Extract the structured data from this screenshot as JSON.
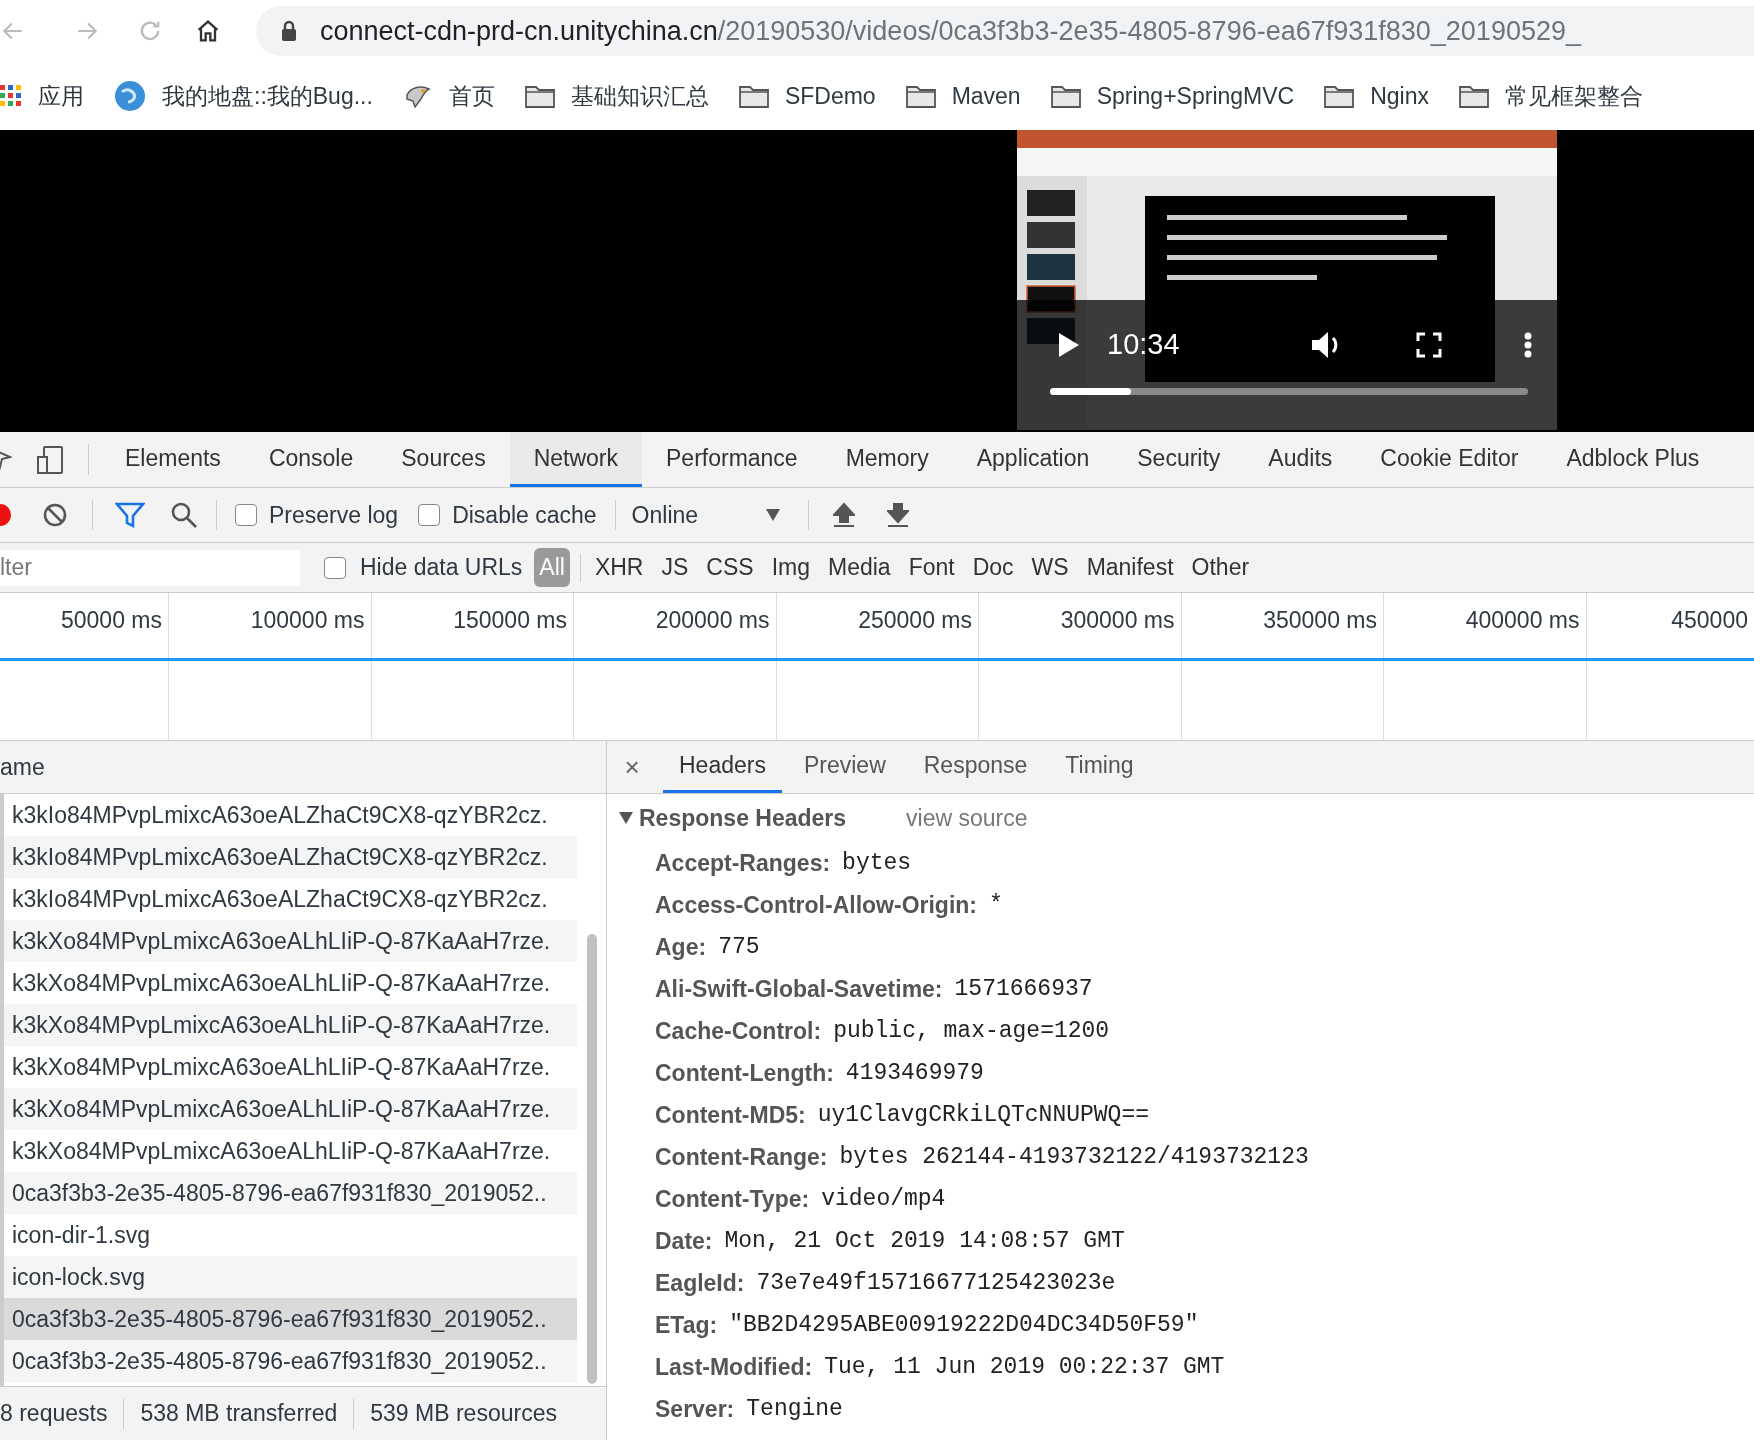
{
  "address": {
    "host": "connect-cdn-prd-cn.unitychina.cn",
    "path": "/20190530/videos/0ca3f3b3-2e35-4805-8796-ea67f931f830_20190529_"
  },
  "bookmarks": [
    {
      "label": "应用",
      "kind": "apps"
    },
    {
      "label": "我的地盘::我的Bug...",
      "kind": "globe"
    },
    {
      "label": "首页",
      "kind": "bird"
    },
    {
      "label": "基础知识汇总",
      "kind": "folder"
    },
    {
      "label": "SFDemo",
      "kind": "folder"
    },
    {
      "label": "Maven",
      "kind": "folder"
    },
    {
      "label": "Spring+SpringMVC",
      "kind": "folder"
    },
    {
      "label": "Nginx",
      "kind": "folder"
    },
    {
      "label": "常见框架整合",
      "kind": "folder"
    }
  ],
  "video": {
    "time": "10:34",
    "level": 0.17
  },
  "devtools": {
    "tabs": [
      {
        "label": "Elements",
        "selected": false
      },
      {
        "label": "Console",
        "selected": false
      },
      {
        "label": "Sources",
        "selected": false
      },
      {
        "label": "Network",
        "selected": true
      },
      {
        "label": "Performance",
        "selected": false
      },
      {
        "label": "Memory",
        "selected": false
      },
      {
        "label": "Application",
        "selected": false
      },
      {
        "label": "Security",
        "selected": false
      },
      {
        "label": "Audits",
        "selected": false
      },
      {
        "label": "Cookie Editor",
        "selected": false
      },
      {
        "label": "Adblock Plus",
        "selected": false
      }
    ],
    "options": [
      {
        "label": "Preserve log",
        "checked": false
      },
      {
        "label": "Disable cache",
        "checked": false
      }
    ],
    "throttling": "Online",
    "filter": {
      "placeholder": "lter",
      "hide_data_urls": {
        "label": "Hide data URLs",
        "checked": false
      },
      "types": [
        {
          "label": "All",
          "selected": true
        },
        {
          "label": "XHR",
          "selected": false
        },
        {
          "label": "JS",
          "selected": false
        },
        {
          "label": "CSS",
          "selected": false
        },
        {
          "label": "Img",
          "selected": false
        },
        {
          "label": "Media",
          "selected": false
        },
        {
          "label": "Font",
          "selected": false
        },
        {
          "label": "Doc",
          "selected": false
        },
        {
          "label": "WS",
          "selected": false
        },
        {
          "label": "Manifest",
          "selected": false
        },
        {
          "label": "Other",
          "selected": false
        }
      ]
    },
    "timeline": [
      "50000 ms",
      "100000 ms",
      "150000 ms",
      "200000 ms",
      "250000 ms",
      "300000 ms",
      "350000 ms",
      "400000 ms",
      "450000"
    ],
    "requests": {
      "column": "ame",
      "rows": [
        {
          "name": "k3kIo84MPvpLmixcA63oeALZhaCt9CX8-qzYBR2cz.",
          "selected": false
        },
        {
          "name": "k3kIo84MPvpLmixcA63oeALZhaCt9CX8-qzYBR2cz.",
          "selected": false
        },
        {
          "name": "k3kIo84MPvpLmixcA63oeALZhaCt9CX8-qzYBR2cz.",
          "selected": false
        },
        {
          "name": "k3kXo84MPvpLmixcA63oeALhLIiP-Q-87KaAaH7rze.",
          "selected": false
        },
        {
          "name": "k3kXo84MPvpLmixcA63oeALhLIiP-Q-87KaAaH7rze.",
          "selected": false
        },
        {
          "name": "k3kXo84MPvpLmixcA63oeALhLIiP-Q-87KaAaH7rze.",
          "selected": false
        },
        {
          "name": "k3kXo84MPvpLmixcA63oeALhLIiP-Q-87KaAaH7rze.",
          "selected": false
        },
        {
          "name": "k3kXo84MPvpLmixcA63oeALhLIiP-Q-87KaAaH7rze.",
          "selected": false
        },
        {
          "name": "k3kXo84MPvpLmixcA63oeALhLIiP-Q-87KaAaH7rze.",
          "selected": false
        },
        {
          "name": "0ca3f3b3-2e35-4805-8796-ea67f931f830_2019052..",
          "selected": false
        },
        {
          "name": "icon-dir-1.svg",
          "selected": false
        },
        {
          "name": "icon-lock.svg",
          "selected": false
        },
        {
          "name": "0ca3f3b3-2e35-4805-8796-ea67f931f830_2019052..",
          "selected": true
        },
        {
          "name": "0ca3f3b3-2e35-4805-8796-ea67f931f830_2019052..",
          "selected": false
        }
      ]
    },
    "summary": [
      "8 requests",
      "538 MB transferred",
      "539 MB resources"
    ],
    "detail": {
      "close": "×",
      "tabs": [
        {
          "label": "Headers",
          "selected": true
        },
        {
          "label": "Preview",
          "selected": false
        },
        {
          "label": "Response",
          "selected": false
        },
        {
          "label": "Timing",
          "selected": false
        }
      ],
      "section": {
        "title": "Response Headers",
        "expanded": true,
        "view_source": "view source"
      },
      "headers": [
        {
          "name": "Accept-Ranges:",
          "value": "bytes"
        },
        {
          "name": "Access-Control-Allow-Origin:",
          "value": "*"
        },
        {
          "name": "Age:",
          "value": "775"
        },
        {
          "name": "Ali-Swift-Global-Savetime:",
          "value": "1571666937"
        },
        {
          "name": "Cache-Control:",
          "value": "public, max-age=1200"
        },
        {
          "name": "Content-Length:",
          "value": "4193469979"
        },
        {
          "name": "Content-MD5:",
          "value": "uy1ClavgCRkiLQTcNNUPWQ=="
        },
        {
          "name": "Content-Range:",
          "value": "bytes 262144-4193732122/4193732123"
        },
        {
          "name": "Content-Type:",
          "value": "video/mp4"
        },
        {
          "name": "Date:",
          "value": "Mon, 21 Oct 2019 14:08:57 GMT"
        },
        {
          "name": "EagleId:",
          "value": "73e7e49f15716677125423023e"
        },
        {
          "name": "ETag:",
          "value": "\"BB2D4295ABE00919222D04DC34D50F59\""
        },
        {
          "name": "Last-Modified:",
          "value": "Tue, 11 Jun 2019 00:22:37 GMT"
        },
        {
          "name": "Server:",
          "value": "Tengine"
        }
      ]
    }
  }
}
